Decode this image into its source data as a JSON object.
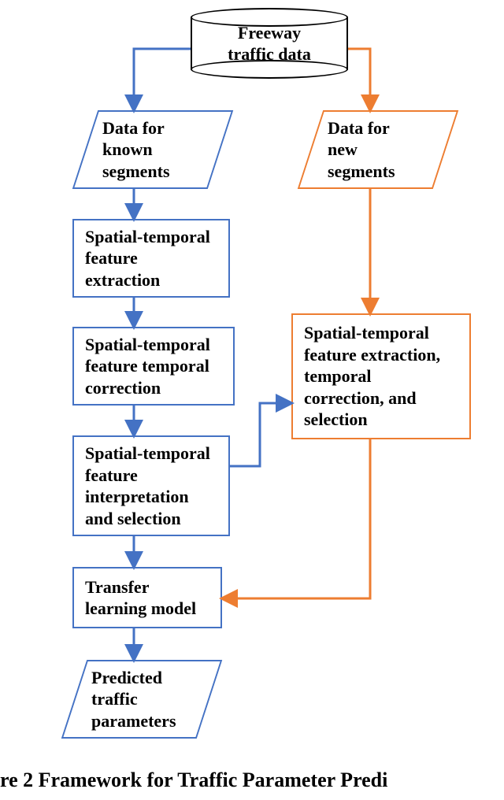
{
  "chart_data": {
    "type": "flowchart",
    "title": "Framework for Traffic Parameter Predi",
    "figure_number": 2,
    "nodes": [
      {
        "id": "source",
        "shape": "cylinder",
        "label": "Freeway\ntraffic data",
        "branch": "root"
      },
      {
        "id": "known",
        "shape": "parallelogram",
        "label": "Data for\nknown\nsegments",
        "branch": "left",
        "color": "#4472C4"
      },
      {
        "id": "new",
        "shape": "parallelogram",
        "label": "Data for\nnew\nsegments",
        "branch": "right",
        "color": "#ED7D31"
      },
      {
        "id": "extract",
        "shape": "rect",
        "label": "Spatial-temporal\nfeature\nextraction",
        "branch": "left",
        "color": "#4472C4"
      },
      {
        "id": "temporal",
        "shape": "rect",
        "label": "Spatial-temporal\nfeature temporal\ncorrection",
        "branch": "left",
        "color": "#4472C4"
      },
      {
        "id": "interpret",
        "shape": "rect",
        "label": "Spatial-temporal\nfeature\ninterpretation\nand selection",
        "branch": "left",
        "color": "#4472C4"
      },
      {
        "id": "combine",
        "shape": "rect",
        "label": "Spatial-temporal\nfeature extraction,\ntemporal\ncorrection,  and\nselection",
        "branch": "right",
        "color": "#ED7D31"
      },
      {
        "id": "transfer",
        "shape": "rect",
        "label": "Transfer\nlearning model",
        "branch": "left",
        "color": "#4472C4"
      },
      {
        "id": "predicted",
        "shape": "parallelogram",
        "label": "Predicted\ntraffic\nparameters",
        "branch": "left",
        "color": "#4472C4"
      }
    ],
    "edges": [
      {
        "from": "source",
        "to": "known",
        "color": "#4472C4"
      },
      {
        "from": "source",
        "to": "new",
        "color": "#ED7D31"
      },
      {
        "from": "known",
        "to": "extract",
        "color": "#4472C4"
      },
      {
        "from": "extract",
        "to": "temporal",
        "color": "#4472C4"
      },
      {
        "from": "temporal",
        "to": "interpret",
        "color": "#4472C4"
      },
      {
        "from": "interpret",
        "to": "transfer",
        "color": "#4472C4"
      },
      {
        "from": "transfer",
        "to": "predicted",
        "color": "#4472C4"
      },
      {
        "from": "interpret",
        "to": "combine",
        "color": "#4472C4"
      },
      {
        "from": "new",
        "to": "combine",
        "color": "#ED7D31"
      },
      {
        "from": "combine",
        "to": "transfer",
        "color": "#ED7D31"
      }
    ]
  },
  "colors": {
    "blue": "#4472C4",
    "orange": "#ED7D31",
    "black": "#000000"
  },
  "nodes": {
    "source": {
      "l1": "Freeway",
      "l2": "traffic data"
    },
    "known": {
      "l1": "Data for",
      "l2": "known",
      "l3": "segments"
    },
    "new": {
      "l1": "Data for",
      "l2": "new",
      "l3": "segments"
    },
    "extract": {
      "l1": "Spatial-temporal",
      "l2": "feature",
      "l3": "extraction"
    },
    "temporal": {
      "l1": "Spatial-temporal",
      "l2": "feature temporal",
      "l3": "correction"
    },
    "interpret": {
      "l1": "Spatial-temporal",
      "l2": "feature",
      "l3": "interpretation",
      "l4": "and selection"
    },
    "combine": {
      "l1": "Spatial-temporal",
      "l2": "feature extraction,",
      "l3": "temporal",
      "l4": "correction,  and",
      "l5": "selection"
    },
    "transfer": {
      "l1": "Transfer",
      "l2": "learning model"
    },
    "predicted": {
      "l1": "Predicted",
      "l2": "traffic",
      "l3": "parameters"
    }
  },
  "caption": "re 2 Framework for Traffic Parameter Predi"
}
